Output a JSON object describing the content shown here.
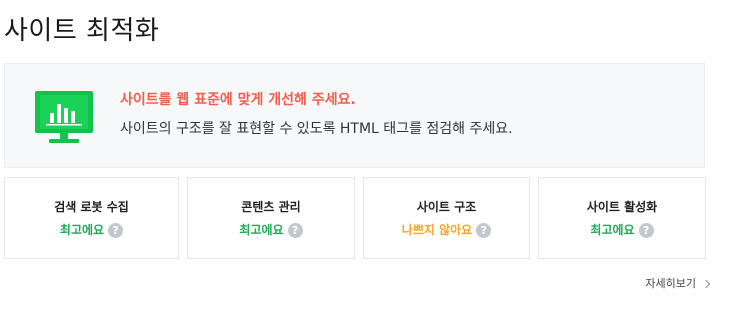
{
  "page": {
    "title": "사이트 최적화"
  },
  "banner": {
    "icon": "monitor-chart-icon",
    "headline": "사이트를 웹 표준에 맞게 개선해 주세요.",
    "description": "사이트의 구조를 잘 표현할 수 있도록 HTML 태그를 점검해 주세요.",
    "colors": {
      "headline": "#f05f4b",
      "icon": "#13c24b"
    }
  },
  "cards": [
    {
      "title": "검색 로봇 수집",
      "status": "최고에요",
      "status_color": "#20a957",
      "help_icon": "question-icon",
      "help_label": "?"
    },
    {
      "title": "콘텐츠 관리",
      "status": "최고에요",
      "status_color": "#20a957",
      "help_icon": "question-icon",
      "help_label": "?"
    },
    {
      "title": "사이트 구조",
      "status": "나쁘지 않아요",
      "status_color": "#f5a623",
      "help_icon": "question-icon",
      "help_label": "?"
    },
    {
      "title": "사이트 활성화",
      "status": "최고에요",
      "status_color": "#20a957",
      "help_icon": "question-icon",
      "help_label": "?"
    }
  ],
  "more_link": {
    "label": "자세히보기",
    "icon": "chevron-right-icon"
  }
}
